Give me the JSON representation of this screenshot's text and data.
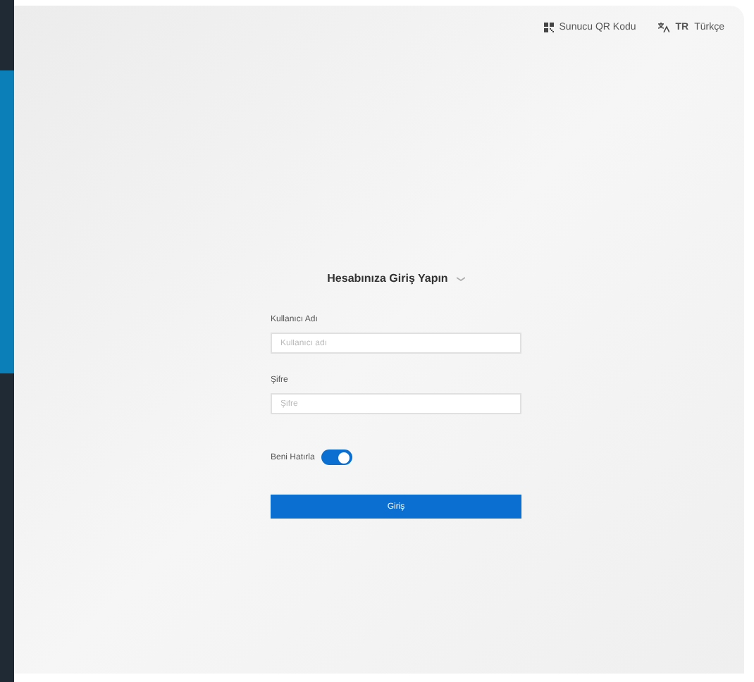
{
  "top_bar": {
    "qr_link": "Sunucu QR Kodu",
    "language": {
      "code": "TR",
      "label": "Türkçe"
    }
  },
  "login": {
    "title": "Hesabınıza Giriş Yapın",
    "fields": [
      {
        "label": "Kullanıcı Adı",
        "placeholder": "Kullanıcı adı"
      },
      {
        "label": "Şifre",
        "placeholder": "Şifre"
      }
    ],
    "remember": {
      "label": "Beni Hatırla",
      "on": true
    },
    "submit": "Giriş"
  }
}
